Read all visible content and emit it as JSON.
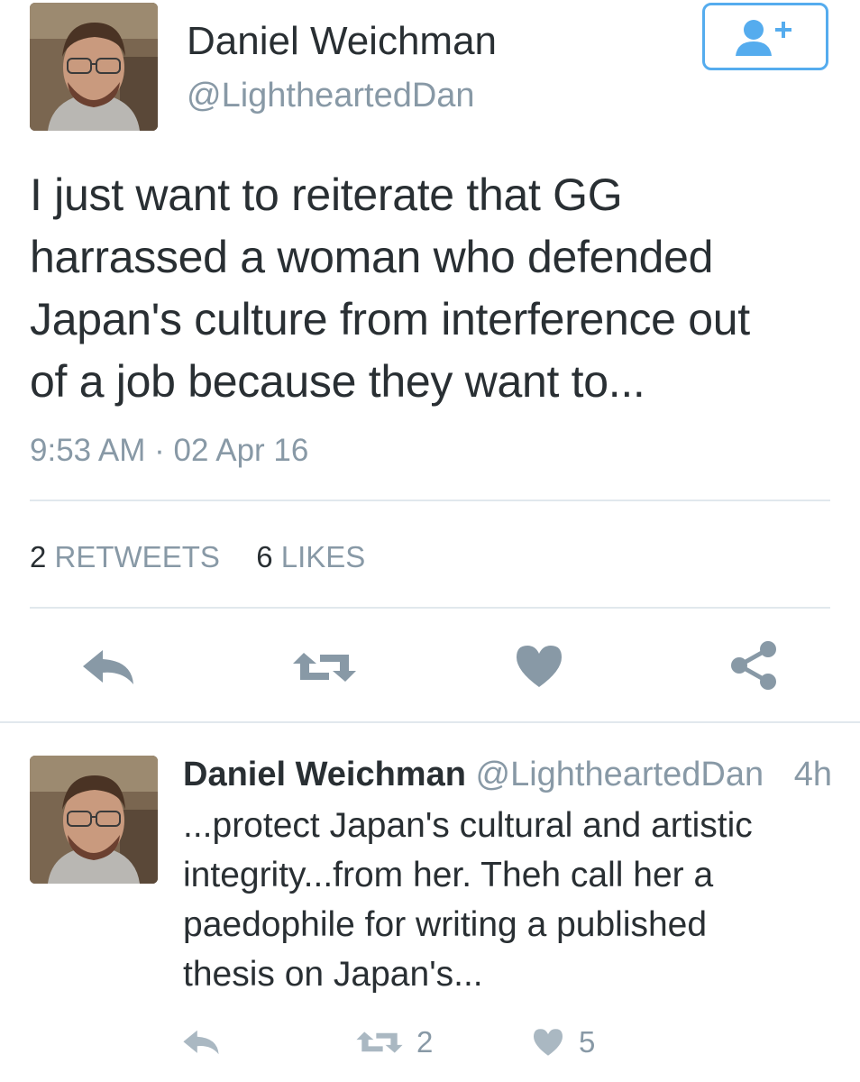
{
  "tweet": {
    "author_name": "Daniel Weichman",
    "author_handle": "@LightheartedDan",
    "text_lines": [
      "I just want to reiterate that GG",
      "harrassed a woman who defended",
      "Japan's culture from interference out",
      "of a job because they want to..."
    ],
    "timestamp": "9:53 AM · 02 Apr 16",
    "retweet_count": "2",
    "retweet_label": "RETWEETS",
    "like_count": "6",
    "like_label": "LIKES"
  },
  "reply": {
    "author_name": "Daniel Weichman",
    "author_handle": "@LightheartedDan",
    "time": "4h",
    "text_lines": [
      "...protect Japan's cultural and artistic",
      "integrity...from her. Theh call her a",
      "paedophile for writing a published",
      "thesis on Japan's..."
    ],
    "retweet_count": "2",
    "like_count": "5"
  },
  "icons": {
    "follow": "add-user-icon",
    "reply": "reply-icon",
    "retweet": "retweet-icon",
    "like": "heart-icon",
    "share": "share-icon"
  },
  "colors": {
    "accent": "#55acee",
    "text": "#292f33",
    "muted": "#8899a6",
    "icon": "#8899a6",
    "icon_light": "#aab8c2",
    "divider": "#e1e8ed"
  }
}
